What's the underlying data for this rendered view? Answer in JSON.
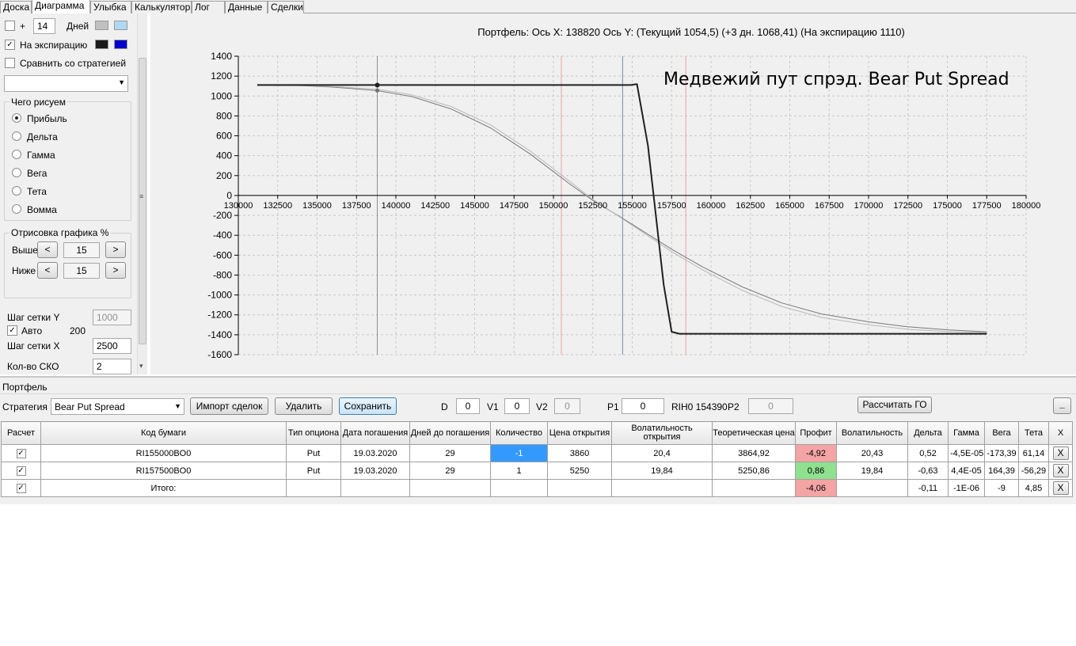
{
  "tabs": [
    {
      "label": "Доска"
    },
    {
      "label": "Диаграмма",
      "active": true
    },
    {
      "label": "Улыбка"
    },
    {
      "label": "Калькулятор"
    },
    {
      "label": "Лог"
    },
    {
      "label": "Данные"
    },
    {
      "label": "Сделки"
    }
  ],
  "left_panel": {
    "plus_label": "+",
    "days_value": "14",
    "days_label": "Дней",
    "expiry_label": "На экспирацию",
    "compare_label": "Сравнить со стратегией",
    "strategy_combo_value": "",
    "what_group_title": "Чего рисуем",
    "radios": [
      {
        "label": "Прибыль",
        "selected": true
      },
      {
        "label": "Дельта",
        "selected": false
      },
      {
        "label": "Гамма",
        "selected": false
      },
      {
        "label": "Вега",
        "selected": false
      },
      {
        "label": "Тета",
        "selected": false
      },
      {
        "label": "Вомма",
        "selected": false
      }
    ],
    "draw_group_title": "Отрисовка графика %",
    "above_label": "Выше",
    "above_value": "15",
    "below_label": "Ниже",
    "below_value": "15",
    "prev_glyph": "<",
    "next_glyph": ">",
    "grid_y_label": "Шаг сетки Y",
    "grid_y_value": "1000",
    "auto_label": "Авто",
    "auto_value": "200",
    "grid_x_label": "Шаг сетки X",
    "grid_x_value": "2500",
    "sko_label": "Кол-во СКО",
    "sko_value": "2",
    "scroll_grip": "≡",
    "scroll_down": "▾",
    "colors": {
      "days_swatch_1": "#c0c0c0",
      "days_swatch_2": "#b0d8f5",
      "expiry_swatch_1": "#1a1a1a",
      "expiry_swatch_2": "#0000c8"
    }
  },
  "chart_data": {
    "type": "line",
    "title": "Портфель: Ось X: 138820 Ось Y:  (Текущий 1054,5)  (+3 дн. 1068,41)  (На экспирацию 1110)",
    "annotation": "Медвежий пут спрэд. Bear Put Spread",
    "xlabel": "",
    "ylabel": "",
    "xlim": [
      130000,
      180000
    ],
    "ylim": [
      -1600,
      1400
    ],
    "x_ticks": [
      130000,
      132500,
      135000,
      137500,
      140000,
      142500,
      145000,
      147500,
      150000,
      152500,
      155000,
      157500,
      160000,
      162500,
      165000,
      167500,
      170000,
      172500,
      175000,
      177500,
      180000
    ],
    "y_ticks": [
      1400,
      1200,
      1000,
      800,
      600,
      400,
      200,
      0,
      -200,
      -400,
      -600,
      -800,
      -1000,
      -1200,
      -1400,
      -1600
    ],
    "grid": true,
    "vertical_lines": [
      {
        "x": 138820,
        "color": "#909090"
      },
      {
        "x": 150500,
        "color": "#f0a0a0"
      },
      {
        "x": 154390,
        "color": "#6f8fa8"
      },
      {
        "x": 158400,
        "color": "#f0a0a0"
      }
    ],
    "marker": {
      "x": 138820,
      "y_current": 1054.5,
      "y_expiry": 1110
    },
    "series": [
      {
        "color": "#202020",
        "width": 2,
        "x": [
          131200,
          154900,
          155300,
          156000,
          157000,
          157500,
          158000,
          177500
        ],
        "y": [
          1110,
          1110,
          1120,
          500,
          -900,
          -1370,
          -1390,
          -1390
        ]
      },
      {
        "color": "#7a7a7a",
        "width": 1,
        "x": [
          131200,
          134000,
          136000,
          138820,
          141000,
          143500,
          146000,
          148500,
          151000,
          152500,
          154390,
          156000,
          157500,
          159500,
          162000,
          164500,
          167000,
          170000,
          172500,
          175000,
          177500
        ],
        "y": [
          1110,
          1105,
          1090,
          1054,
          995,
          870,
          680,
          420,
          120,
          -50,
          -230,
          -390,
          -540,
          -720,
          -920,
          -1080,
          -1190,
          -1270,
          -1320,
          -1350,
          -1370
        ]
      },
      {
        "color": "#b8b8b8",
        "width": 1,
        "x": [
          131200,
          134000,
          136000,
          138820,
          141000,
          143500,
          146000,
          148500,
          151000,
          152500,
          154390,
          156000,
          157500,
          159500,
          162000,
          164500,
          167000,
          170000,
          172500,
          175000,
          177500
        ],
        "y": [
          1112,
          1108,
          1096,
          1068,
          1012,
          895,
          710,
          450,
          145,
          -40,
          -235,
          -405,
          -565,
          -750,
          -955,
          -1115,
          -1225,
          -1300,
          -1345,
          -1368,
          -1380
        ]
      }
    ]
  },
  "portfolio": {
    "section_label": "Портфель",
    "strategy_label": "Стратегия",
    "strategy_value": "Bear Put Spread",
    "import_button": "Импорт сделок",
    "delete_button": "Удалить",
    "save_button": "Сохранить",
    "d_label": "D",
    "d_value": "0",
    "v1_label": "V1",
    "v1_value": "0",
    "v2_label": "V2",
    "v2_value": "0",
    "p1_label": "P1",
    "p1_value": "0",
    "underlying_text": "RIH0 154390",
    "p2_label": "P2",
    "p2_value": "0",
    "calc_go_button": "Рассчитать ГО",
    "minimize_button": "_"
  },
  "table": {
    "columns": [
      "Расчет",
      "Код бумаги",
      "Тип опциона",
      "Дата погашения",
      "Дней до погашения",
      "Количество",
      "Цена открытия",
      "Волатильность открытия",
      "Теоретическая цена",
      "Профит",
      "Волатильность",
      "Дельта",
      "Гамма",
      "Вега",
      "Тета",
      "X"
    ],
    "rows": [
      {
        "checked": true,
        "code": "RI155000BO0",
        "type": "Put",
        "date": "19.03.2020",
        "days": "29",
        "qty": "-1",
        "open_price": "3860",
        "open_vol": "20,4",
        "theo": "3864,92",
        "profit": "-4,92",
        "vol": "20,43",
        "delta": "0,52",
        "gamma": "-4,5E-05",
        "vega": "-173,39",
        "theta": "61,14",
        "x": "X",
        "profit_color": "#f4a4a4",
        "qty_color": "#3399ff"
      },
      {
        "checked": true,
        "code": "RI157500BO0",
        "type": "Put",
        "date": "19.03.2020",
        "days": "29",
        "qty": "1",
        "open_price": "5250",
        "open_vol": "19,84",
        "theo": "5250,86",
        "profit": "0,86",
        "vol": "19,84",
        "delta": "-0,63",
        "gamma": "4,4E-05",
        "vega": "164,39",
        "theta": "-56,29",
        "x": "X",
        "profit_color": "#8fe08f",
        "qty_color": ""
      },
      {
        "checked": true,
        "code": "Итого:",
        "type": "",
        "date": "",
        "days": "",
        "qty": "",
        "open_price": "",
        "open_vol": "",
        "theo": "",
        "profit": "-4,06",
        "vol": "",
        "delta": "-0,11",
        "gamma": "-1E-06",
        "vega": "-9",
        "theta": "4,85",
        "x": "X",
        "profit_color": "#f4a4a4",
        "qty_color": ""
      }
    ]
  }
}
